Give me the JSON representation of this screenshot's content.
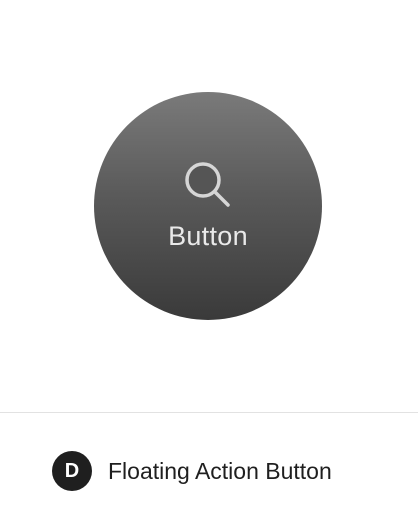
{
  "fab": {
    "label": "Button",
    "icon": "search-icon",
    "gradient_top": "#7a7a7a",
    "gradient_bottom": "#3a3a3a",
    "label_color": "#e9e9e9"
  },
  "caption": {
    "badge_letter": "D",
    "title": "Floating Action Button"
  }
}
